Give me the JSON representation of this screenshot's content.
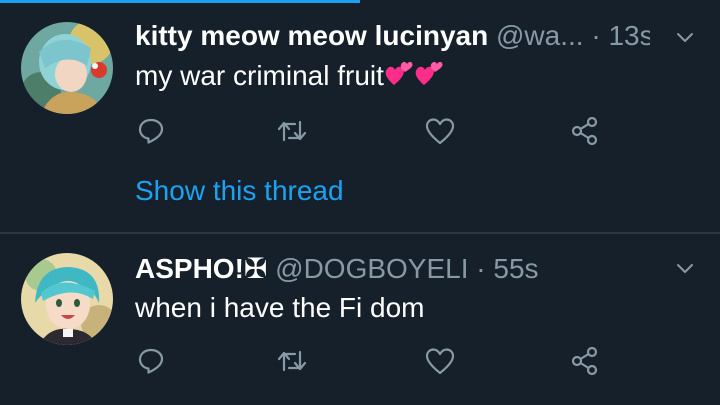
{
  "colors": {
    "background": "#15202b",
    "accent": "#1da1f2",
    "secondary_text": "#8899a6",
    "divider": "#2a3642"
  },
  "tweets": [
    {
      "display_name": "kitty meow meow lucinyan",
      "handle": "@wa...",
      "separator": "·",
      "time": "13s",
      "text": "my war criminal fruit",
      "emojis": [
        "two-hearts-icon",
        "two-hearts-icon"
      ],
      "show_thread": "Show this thread"
    },
    {
      "display_name": "ASPHO!✠",
      "handle": "@DOGBOYELI",
      "separator": "·",
      "time": "55s",
      "text": "when i have the Fi dom"
    }
  ],
  "action_icons": [
    "reply-icon",
    "retweet-icon",
    "like-icon",
    "share-icon"
  ]
}
